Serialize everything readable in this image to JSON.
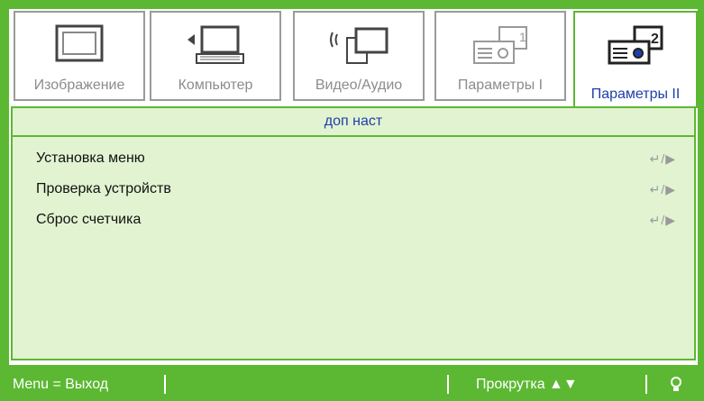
{
  "tabs": [
    {
      "label": "Изображение",
      "icon": "monitor-icon",
      "active": false
    },
    {
      "label": "Компьютер",
      "icon": "laptop-icon",
      "active": false
    },
    {
      "label": "Видео/Аудио",
      "icon": "tv-icon",
      "active": false
    },
    {
      "label": "Параметры I",
      "icon": "projector-1-icon",
      "active": false
    },
    {
      "label": "Параметры II",
      "icon": "projector-2-icon",
      "active": true
    }
  ],
  "panel": {
    "title": "доп наст",
    "rows": [
      {
        "label": "Установка меню",
        "control": "↵/▶"
      },
      {
        "label": "Проверка устройств",
        "control": "↵/▶"
      },
      {
        "label": "Сброс счетчика",
        "control": "↵/▶"
      }
    ]
  },
  "footer": {
    "exit": "Menu = Выход",
    "scroll": "Прокрутка ▲▼",
    "lamp_icon": "lamp-icon"
  },
  "colors": {
    "frame": "#5cb832",
    "panel": "#e2f3d1",
    "accent_text": "#1f3fa7",
    "inactive_text": "#8c8c8c"
  }
}
